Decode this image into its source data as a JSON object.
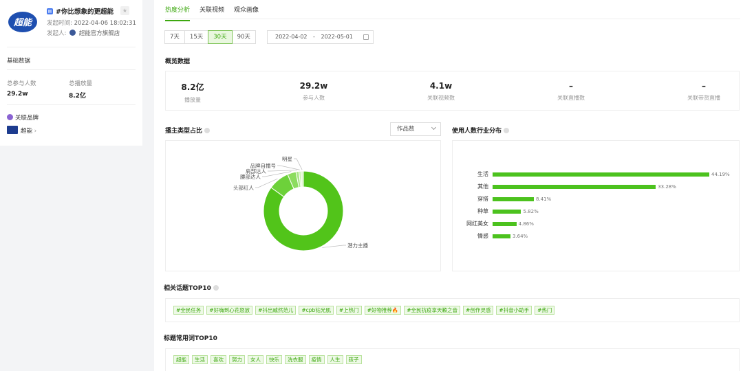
{
  "sidebar": {
    "topic_title": "#你比想象的更超能",
    "launch_time_label": "发起时间:",
    "launch_time_value": "2022-04-06 18:02:31",
    "launcher_label": "发起人:",
    "launcher_value": "超能官方旗舰店",
    "basic_title": "基础数据",
    "participants_label": "总参与人数",
    "participants_value": "29.2w",
    "plays_label": "总播放量",
    "plays_value": "8.2亿",
    "brand_title": "关联品牌",
    "brand_name": "超能",
    "logo_text": "超能"
  },
  "tabs": [
    {
      "label": "热度分析",
      "active": true
    },
    {
      "label": "关联视频",
      "active": false
    },
    {
      "label": "观众画像",
      "active": false
    }
  ],
  "range": [
    "7天",
    "15天",
    "30天",
    "90天"
  ],
  "range_active": "30天",
  "date_range": {
    "start": "2022-04-02",
    "sep": "-",
    "end": "2022-05-01"
  },
  "overview": {
    "title": "概览数据",
    "items": [
      {
        "value": "8.2亿",
        "label": "播放量"
      },
      {
        "value": "29.2w",
        "label": "参与人数"
      },
      {
        "value": "4.1w",
        "label": "关联视频数"
      },
      {
        "value": "–",
        "label": "关联直播数"
      },
      {
        "value": "–",
        "label": "关联带货直播"
      }
    ]
  },
  "pie": {
    "title": "播主类型占比",
    "select_value": "作品数"
  },
  "barchart": {
    "title": "使用人数行业分布"
  },
  "chart_data": [
    {
      "type": "pie",
      "donut": true,
      "slices": [
        {
          "label": "潜力主播",
          "value": 85.0
        },
        {
          "label": "头部红人",
          "value": 8.5
        },
        {
          "label": "腰部达人",
          "value": 3.5
        },
        {
          "label": "肩部达人",
          "value": 1.2
        },
        {
          "label": "品牌自播号",
          "value": 0.8
        },
        {
          "label": "明星",
          "value": 1.0
        }
      ],
      "colors": [
        "#52c41a",
        "#6dd13a",
        "#8cdc5f",
        "#a8e585",
        "#c4eea9",
        "#dff6cf"
      ],
      "legend": "none"
    },
    {
      "type": "bar",
      "orientation": "horizontal",
      "categories": [
        "生活",
        "其他",
        "穿搭",
        "种草",
        "网红美女",
        "情感"
      ],
      "values": [
        44.19,
        33.28,
        8.41,
        5.82,
        4.86,
        3.64
      ],
      "labels": [
        "44.19%",
        "33.28%",
        "8.41%",
        "5.82%",
        "4.86%",
        "3.64%"
      ],
      "color": "#4cc21e"
    }
  ],
  "topics": {
    "title": "相关话题TOP10",
    "tags": [
      "#全民任务",
      "#好嗨到心花怒放",
      "#抖出威然范儿",
      "#cpb钻光肌",
      "#上热门",
      "#好物推荐🔥",
      "#全民抗疫享天籁之音",
      "#创作灵感",
      "#抖音小助手",
      "#热门"
    ]
  },
  "words": {
    "title": "标题常用词TOP10",
    "tags": [
      "超能",
      "生活",
      "喜欢",
      "努力",
      "女人",
      "快乐",
      "洗衣服",
      "疫情",
      "人生",
      "孩子"
    ]
  }
}
